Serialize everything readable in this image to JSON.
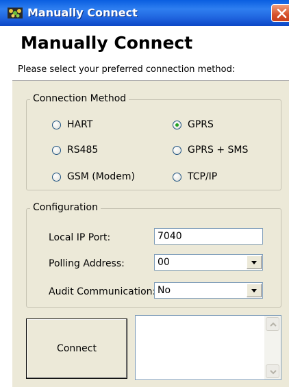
{
  "window": {
    "title": "Manually Connect",
    "close_icon": "close-icon",
    "app_icon": "app-icon"
  },
  "header": {
    "title": "Manually Connect",
    "subtitle": "Please select your preferred connection method:"
  },
  "connection_method": {
    "label": "Connection Method",
    "selected": "GPRS",
    "options": [
      "HART",
      "GPRS",
      "RS485",
      "GPRS + SMS",
      "GSM (Modem)",
      "TCP/IP"
    ]
  },
  "configuration": {
    "label": "Configuration",
    "local_ip_port": {
      "label": "Local IP Port:",
      "value": "7040"
    },
    "polling_address": {
      "label": "Polling Address:",
      "value": "00"
    },
    "audit_communication": {
      "label": "Audit Communication:",
      "value": "No"
    }
  },
  "actions": {
    "connect_label": "Connect"
  },
  "colors": {
    "titlebar": "#1f63de",
    "dialog_bg": "#ece9d8",
    "radio_checked": "#21a121"
  }
}
